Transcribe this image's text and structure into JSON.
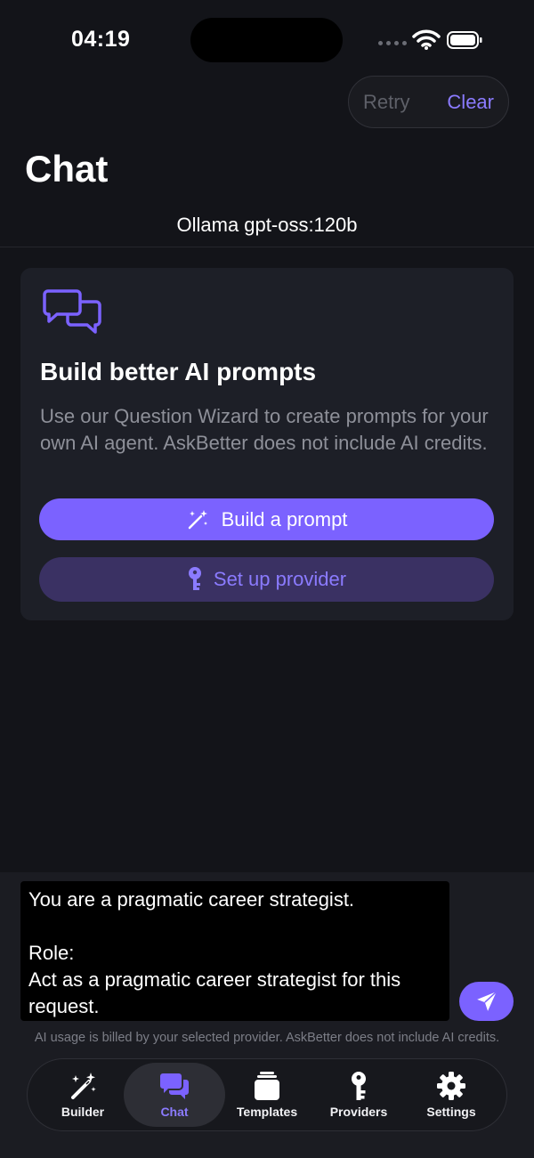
{
  "status_bar": {
    "time": "04:19"
  },
  "header": {
    "retry_label": "Retry",
    "clear_label": "Clear",
    "title": "Chat",
    "model_label": "Ollama  gpt-oss:120b"
  },
  "card": {
    "icon": "chat-bubbles-icon",
    "title": "Build better AI prompts",
    "description": "Use our Question Wizard to create prompts for your own AI agent. AskBetter does not include AI credits.",
    "primary_button": {
      "label": "Build a prompt",
      "icon": "magic-wand-icon"
    },
    "secondary_button": {
      "label": "Set up provider",
      "icon": "key-icon"
    }
  },
  "composer": {
    "value": "You are a pragmatic career strategist.\n\nRole:\nAct as a pragmatic career strategist for this request.",
    "send_icon": "send-icon",
    "billing_note": "AI usage is billed by your selected provider. AskBetter does not include AI credits."
  },
  "tabs": [
    {
      "label": "Builder",
      "icon": "magic-wand-icon"
    },
    {
      "label": "Chat",
      "icon": "chat-bubbles-icon",
      "active": true
    },
    {
      "label": "Templates",
      "icon": "template-icon"
    },
    {
      "label": "Providers",
      "icon": "key-icon"
    },
    {
      "label": "Settings",
      "icon": "gear-icon"
    }
  ],
  "colors": {
    "accent": "#7b62ff",
    "accent_text": "#8b7bff",
    "background": "#131419",
    "card": "#1d1f27"
  }
}
